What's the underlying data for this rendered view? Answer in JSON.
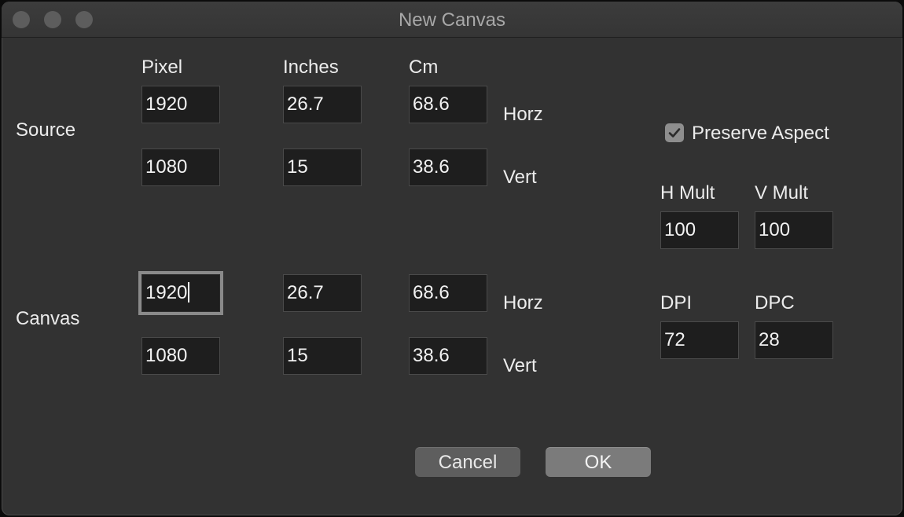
{
  "window": {
    "title": "New Canvas"
  },
  "columns": {
    "pixel": "Pixel",
    "inches": "Inches",
    "cm": "Cm"
  },
  "source": {
    "label": "Source",
    "horz": {
      "pixel": "1920",
      "inches": "26.7",
      "cm": "68.6",
      "label": "Horz"
    },
    "vert": {
      "pixel": "1080",
      "inches": "15",
      "cm": "38.6",
      "label": "Vert"
    }
  },
  "canvas": {
    "label": "Canvas",
    "horz": {
      "pixel": "1920",
      "inches": "26.7",
      "cm": "68.6",
      "label": "Horz"
    },
    "vert": {
      "pixel": "1080",
      "inches": "15",
      "cm": "38.6",
      "label": "Vert"
    }
  },
  "preserve_aspect": {
    "label": "Preserve Aspect",
    "checked": true
  },
  "mult": {
    "h_label": "H Mult",
    "v_label": "V Mult",
    "h_value": "100",
    "v_value": "100"
  },
  "resolution": {
    "dpi_label": "DPI",
    "dpc_label": "DPC",
    "dpi_value": "72",
    "dpc_value": "28"
  },
  "buttons": {
    "cancel": "Cancel",
    "ok": "OK"
  },
  "icons": {
    "checkbox": "checkmark-icon",
    "traffic_lights": [
      "close-icon",
      "minimize-icon",
      "zoom-icon"
    ]
  }
}
